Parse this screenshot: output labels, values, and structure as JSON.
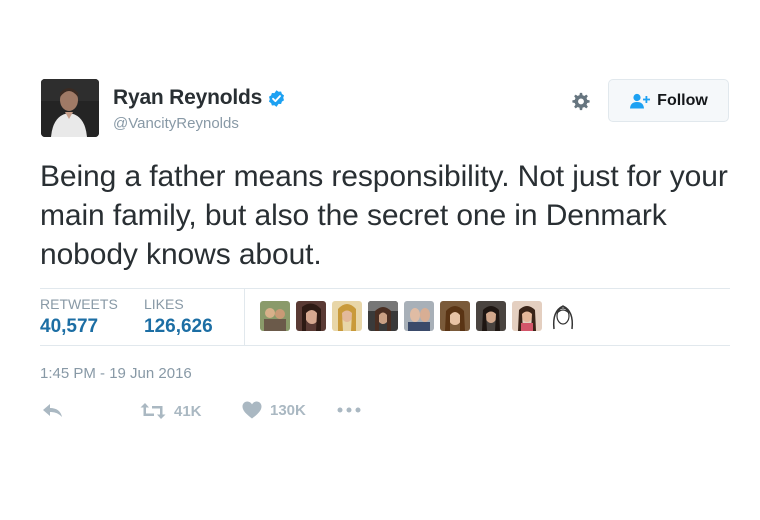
{
  "user": {
    "display_name": "Ryan Reynolds",
    "handle": "@VancityReynolds",
    "verified": true
  },
  "header": {
    "settings_icon": "gear-icon",
    "follow_label": "Follow",
    "follow_icon": "add-user-icon"
  },
  "tweet": {
    "text": "Being a father means responsibility. Not just for your main family, but also the secret one in Denmark nobody knows about.",
    "timestamp": "1:45 PM - 19 Jun 2016"
  },
  "stats": {
    "retweets_label": "RETWEETS",
    "retweets_value": "40,577",
    "likes_label": "LIKES",
    "likes_value": "126,626"
  },
  "actions": {
    "reply_icon": "reply-icon",
    "retweet_icon": "retweet-icon",
    "retweet_count": "41K",
    "like_icon": "heart-icon",
    "like_count": "130K",
    "more_icon": "more-icon"
  },
  "colors": {
    "accent": "#1c6ea4",
    "verified": "#1da1f2",
    "muted": "#8899a6",
    "action_gray": "#aab8c2",
    "text": "#292f33"
  }
}
